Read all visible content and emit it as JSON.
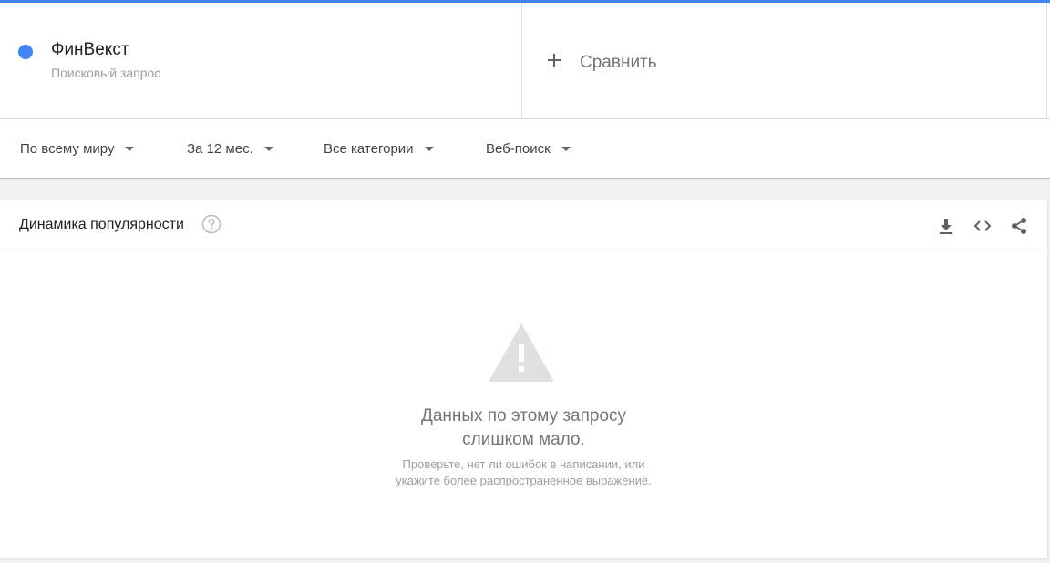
{
  "colors": {
    "accent": "#4285f4",
    "series_dot": "#4285f4",
    "icon_gray": "#616161",
    "warning_gray": "#e0e0e0"
  },
  "compare": {
    "term": {
      "name": "ФинВекст",
      "type": "Поисковый запрос"
    },
    "add_label": "Сравнить",
    "add_icon": "plus-icon"
  },
  "filters": [
    {
      "label": "По всему миру",
      "icon": "caret-down-icon"
    },
    {
      "label": "За 12 мес.",
      "icon": "caret-down-icon"
    },
    {
      "label": "Все категории",
      "icon": "caret-down-icon"
    },
    {
      "label": "Веб-поиск",
      "icon": "caret-down-icon"
    }
  ],
  "interest_panel": {
    "title": "Динамика популярности",
    "icons": [
      "help-icon",
      "download-icon",
      "embed-icon",
      "share-icon"
    ],
    "empty_state": {
      "icon": "warning-icon",
      "title_line1": "Данных по этому запросу",
      "title_line2": "слишком мало.",
      "hint_line1": "Проверьте, нет ли ошибок в написании, или",
      "hint_line2": "укажите более распространенное выражение."
    }
  }
}
